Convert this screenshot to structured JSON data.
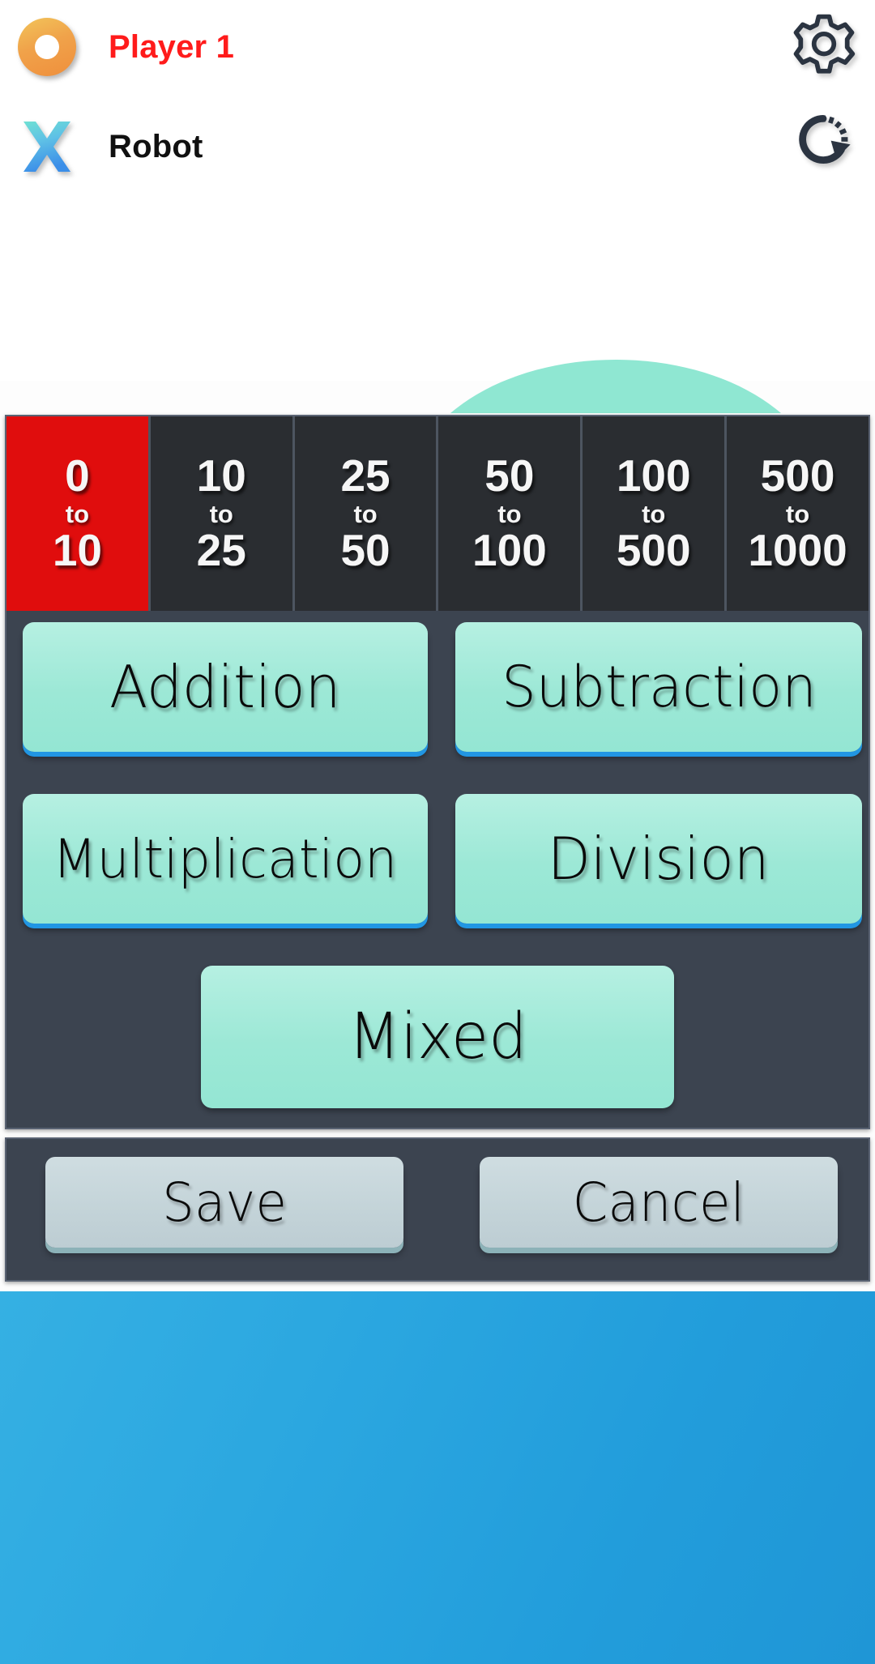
{
  "header": {
    "players": [
      {
        "icon": "circle-o-icon",
        "name": "Player 1",
        "active": true
      },
      {
        "icon": "cross-x-icon",
        "name": "Robot",
        "active": false
      }
    ],
    "icons": [
      {
        "name": "gear-icon",
        "label": "Settings"
      },
      {
        "name": "speed-icon",
        "label": "Restart"
      }
    ]
  },
  "settings_panel": {
    "ranges": [
      {
        "from": "0",
        "to": "10",
        "mid": "to",
        "selected": true
      },
      {
        "from": "10",
        "to": "25",
        "mid": "to",
        "selected": false
      },
      {
        "from": "25",
        "to": "50",
        "mid": "to",
        "selected": false
      },
      {
        "from": "50",
        "to": "100",
        "mid": "to",
        "selected": false
      },
      {
        "from": "100",
        "to": "500",
        "mid": "to",
        "selected": false
      },
      {
        "from": "500",
        "to": "1000",
        "mid": "to",
        "selected": false
      }
    ],
    "operations": [
      {
        "label": "Addition",
        "selected": true
      },
      {
        "label": "Subtraction",
        "selected": true
      },
      {
        "label": "Multiplication",
        "selected": true
      },
      {
        "label": "Division",
        "selected": true
      },
      {
        "label": "Mixed",
        "selected": false
      }
    ]
  },
  "actions": {
    "save_label": "Save",
    "cancel_label": "Cancel"
  },
  "colors": {
    "selected_range": "#e00d0d",
    "panel": "#3c4450",
    "tab_strip": "#2a2d31",
    "button_mint": "#9ce8d6",
    "button_edge_blue": "#2196e3",
    "action_button": "#c3d3d8",
    "action_edge": "#8cb2b8",
    "arc_mint": "#8fe7d2",
    "bottom_blue": "#2ba7e0",
    "active_player_text": "#ff1b1b"
  }
}
